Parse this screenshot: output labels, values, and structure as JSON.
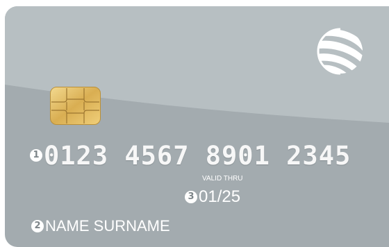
{
  "card": {
    "number_marker": "1",
    "number": "0123 4567 8901 2345",
    "valid_label": "VALID THRU",
    "expiry_marker": "3",
    "expiry": "01/25",
    "name_marker": "2",
    "holder_name": "NAME SURNAME"
  },
  "colors": {
    "card_top": "#b7bfc2",
    "card_bottom": "#a3abaf",
    "text": "#ffffff",
    "chip_gold": "#e1bb62"
  },
  "icons": {
    "chip": "chip-icon",
    "logo": "globe-logo-icon"
  }
}
